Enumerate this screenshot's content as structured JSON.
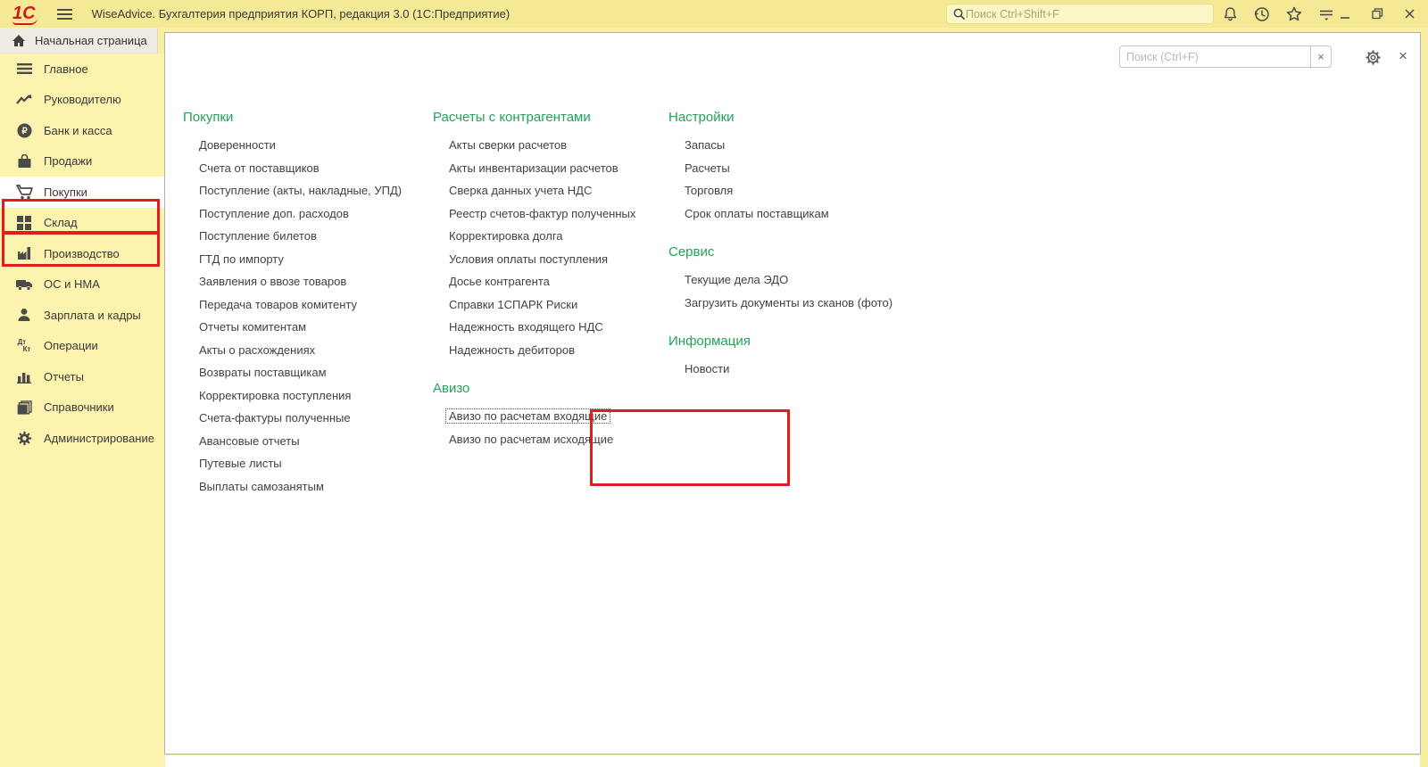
{
  "titlebar": {
    "logo": "1С",
    "title": "WiseAdvice. Бухгалтерия предприятия КОРП, редакция 3.0  (1С:Предприятие)",
    "search_placeholder": "Поиск Ctrl+Shift+F",
    "minimize_label": "–",
    "close_label": "×"
  },
  "tabbar": {
    "home_tab_label": "Начальная страница"
  },
  "sidebar": {
    "items": [
      {
        "icon": "menu-lines-icon",
        "label": "Главное"
      },
      {
        "icon": "trend-icon",
        "label": "Руководителю"
      },
      {
        "icon": "ruble-icon",
        "label": "Банк и касса"
      },
      {
        "icon": "briefcase-icon",
        "label": "Продажи"
      },
      {
        "icon": "cart-icon",
        "label": "Покупки"
      },
      {
        "icon": "warehouse-icon",
        "label": "Склад"
      },
      {
        "icon": "factory-icon",
        "label": "Производство"
      },
      {
        "icon": "truck-icon",
        "label": "ОС и НМА"
      },
      {
        "icon": "person-icon",
        "label": "Зарплата и кадры"
      },
      {
        "icon": "dtkt-icon",
        "label": "Операции",
        "dt": "Дт",
        "kt": "Кт"
      },
      {
        "icon": "barchart-icon",
        "label": "Отчеты"
      },
      {
        "icon": "books-icon",
        "label": "Справочники"
      },
      {
        "icon": "gear-icon",
        "label": "Администрирование"
      }
    ]
  },
  "panel": {
    "search_placeholder": "Поиск (Ctrl+F)",
    "clear_label": "×",
    "close_label": "×"
  },
  "sections": {
    "purchases": {
      "title": "Покупки",
      "items": [
        "Доверенности",
        "Счета от поставщиков",
        "Поступление (акты, накладные, УПД)",
        "Поступление доп. расходов",
        "Поступление билетов",
        "ГТД по импорту",
        "Заявления о ввозе товаров",
        "Передача товаров комитенту",
        "Отчеты комитентам",
        "Акты о расхождениях",
        "Возвраты поставщикам",
        "Корректировка поступления",
        "Счета-фактуры полученные",
        "Авансовые отчеты",
        "Путевые листы",
        "Выплаты самозанятым"
      ]
    },
    "contractors": {
      "title": "Расчеты с контрагентами",
      "items": [
        "Акты сверки расчетов",
        "Акты инвентаризации расчетов",
        "Сверка данных учета НДС",
        "Реестр счетов-фактур полученных",
        "Корректировка долга",
        "Условия оплаты поступления",
        "Досье контрагента",
        "Справки 1СПАРК Риски",
        "Надежность входящего НДС",
        "Надежность дебиторов"
      ]
    },
    "avizo": {
      "title": "Авизо",
      "items": [
        "Авизо по расчетам входящие",
        "Авизо по расчетам исходящие"
      ]
    },
    "settings": {
      "title": "Настройки",
      "items": [
        "Запасы",
        "Расчеты",
        "Торговля",
        "Срок оплаты поставщикам"
      ]
    },
    "service": {
      "title": "Сервис",
      "items": [
        "Текущие дела ЭДО",
        "Загрузить документы из сканов (фото)"
      ]
    },
    "info": {
      "title": "Информация",
      "items": [
        "Новости"
      ]
    }
  },
  "colors": {
    "accent_green": "#22a257",
    "annotation_red": "#e01e1e",
    "logo_red": "#d8161f",
    "topbar_yellow": "#f6e995",
    "sidebar_yellow": "#fcf3ae"
  }
}
